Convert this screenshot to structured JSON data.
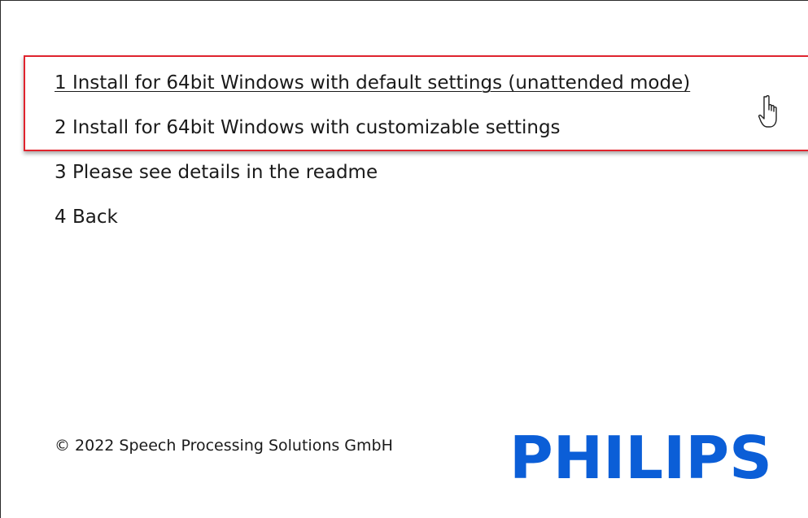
{
  "menu": {
    "items": [
      {
        "label": "1 Install for 64bit Windows with default settings (unattended mode)"
      },
      {
        "label": "2 Install for 64bit Windows with customizable settings"
      },
      {
        "label": "3 Please see details in the readme"
      },
      {
        "label": "4 Back"
      }
    ]
  },
  "footer": {
    "copyright": "© 2022 Speech Processing Solutions GmbH",
    "logo_text": "PHILIPS"
  },
  "colors": {
    "highlight_border": "#e0242e",
    "logo_blue": "#0b5ed7",
    "text": "#1a1a1a"
  },
  "icons": {
    "cursor": "hand-pointer-icon"
  }
}
